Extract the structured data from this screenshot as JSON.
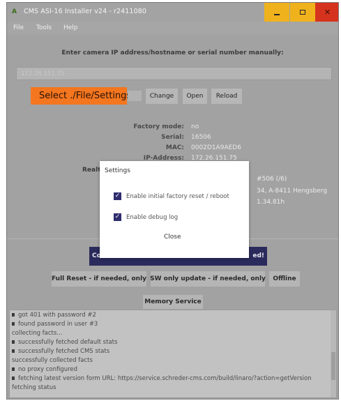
{
  "window": {
    "title": "CMS ASI-16 Installer v24 - r2411080",
    "app_icon": "A"
  },
  "menu": [
    "File",
    "Tools",
    "Help"
  ],
  "main": {
    "prompt": "Enter camera IP address/hostname or serial number manually:",
    "ip_value": "172.26.151.75",
    "banner": "Select ./File/Settings",
    "buttons": {
      "change": "Change",
      "open": "Open",
      "reload": "Reload"
    },
    "info": [
      {
        "label": "Factory mode:",
        "value": "no"
      },
      {
        "label": "Serial:",
        "value": "16506"
      },
      {
        "label": "MAC:",
        "value": "0002D1A9AED6"
      },
      {
        "label": "IP-Address:",
        "value": "172.26.151.75"
      }
    ],
    "partial_label": "Realt",
    "side_fragments": [
      "#506 (/6)",
      "34, A-8411 Hengsberg",
      "1.34.81h"
    ],
    "navy_bar": {
      "left": "Co",
      "right": "ed!"
    },
    "actions": {
      "full_reset": "Full Reset - if needed, only",
      "sw_update": "SW only update - if needed, only",
      "offline": "Offline"
    },
    "memory_service": "Memory Service"
  },
  "log": [
    {
      "bullet": true,
      "text": "got 401 with password #2"
    },
    {
      "bullet": true,
      "text": "found password in user #3"
    },
    {
      "bullet": false,
      "text": "collecting facts..."
    },
    {
      "bullet": true,
      "text": "successfully fetched default stats"
    },
    {
      "bullet": true,
      "text": "successfully fetched CMS stats"
    },
    {
      "bullet": false,
      "text": "successfully collected facts"
    },
    {
      "bullet": true,
      "text": "no proxy configured"
    },
    {
      "bullet": true,
      "text": "fetching latest version form URL: https://service.schreder-cms.com/build/linaro/?action=getVersion"
    },
    {
      "bullet": false,
      "text": "fetching status"
    }
  ],
  "dialog": {
    "title": "Settings",
    "options": [
      {
        "label": "Enable initial factory reset / reboot",
        "checked": true
      },
      {
        "label": "Enable debug log",
        "checked": true
      }
    ],
    "close": "Close"
  },
  "colors": {
    "banner": "#f4761f",
    "minimize": "#efb21c",
    "maximize": "#efb21c",
    "close": "#d6331e",
    "checkbox": "#2f2d6e",
    "navy_bar": "#2b2a5c"
  }
}
